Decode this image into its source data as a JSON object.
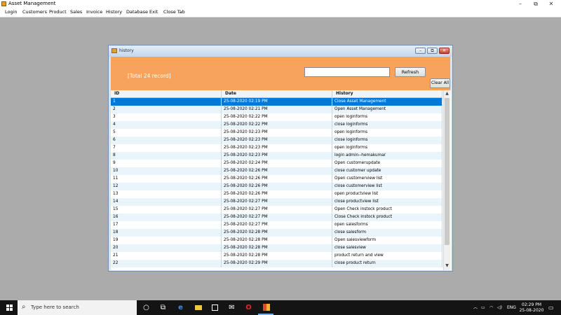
{
  "app": {
    "title": "Asset Management",
    "controls": {
      "minimize": "–",
      "maximize": "⧉",
      "close": "✕"
    }
  },
  "menu": [
    "Login",
    "Customers",
    "Product",
    "Sales",
    "Invoice",
    "History",
    "Database",
    "Exit",
    "Close Tab"
  ],
  "history_window": {
    "title": "history",
    "total_label": "[Total   24 record]",
    "search": {
      "value": "",
      "placeholder": ""
    },
    "refresh_label": "Refresh",
    "clear_label": "Clear All",
    "columns": [
      "ID",
      "Date",
      "History"
    ],
    "selected_row": 0,
    "rows": [
      [
        "1",
        "25-08-2020 02:19 PM",
        "Close Asset Management"
      ],
      [
        "2",
        "25-08-2020 02:21 PM",
        "Open Asset Management"
      ],
      [
        "3",
        "25-08-2020 02:22 PM",
        "open loginforms"
      ],
      [
        "4",
        "25-08-2020 02:22 PM",
        "close loginforms"
      ],
      [
        "5",
        "25-08-2020 02:23 PM",
        "open loginforms"
      ],
      [
        "6",
        "25-08-2020 02:23 PM",
        "close loginforms"
      ],
      [
        "7",
        "25-08-2020 02:23 PM",
        "open loginforms"
      ],
      [
        "8",
        "25-08-2020 02:23 PM",
        "login admin--hemakumar"
      ],
      [
        "9",
        "25-08-2020 02:24 PM",
        "Open customerupdate"
      ],
      [
        "10",
        "25-08-2020 02:26 PM",
        "close customer update"
      ],
      [
        "11",
        "25-08-2020 02:26 PM",
        "Open customerview list"
      ],
      [
        "12",
        "25-08-2020 02:26 PM",
        "close customerview list"
      ],
      [
        "13",
        "25-08-2020 02:26 PM",
        "open productview list"
      ],
      [
        "14",
        "25-08-2020 02:27 PM",
        "close productview list"
      ],
      [
        "15",
        "25-08-2020 02:27 PM",
        "Open Check instock product"
      ],
      [
        "16",
        "25-08-2020 02:27 PM",
        "Close Check instock product"
      ],
      [
        "17",
        "25-08-2020 02:27 PM",
        "open salesforms"
      ],
      [
        "18",
        "25-08-2020 02:28 PM",
        "close salesform"
      ],
      [
        "19",
        "25-08-2020 02:28 PM",
        "Open salesviewform"
      ],
      [
        "20",
        "25-08-2020 02:28 PM",
        "close salesview"
      ],
      [
        "21",
        "25-08-2020 02:28 PM",
        "product return and view"
      ],
      [
        "22",
        "25-08-2020 02:29 PM",
        "close product return"
      ]
    ]
  },
  "taskbar": {
    "search_placeholder": "Type here to search",
    "language": "ENG",
    "time": "02:29 PM",
    "date": "25-08-2020",
    "pinned": [
      "task-view-icon",
      "edge-icon",
      "file-explorer-icon",
      "store-icon",
      "mail-icon",
      "opera-icon",
      "app-icon"
    ]
  }
}
